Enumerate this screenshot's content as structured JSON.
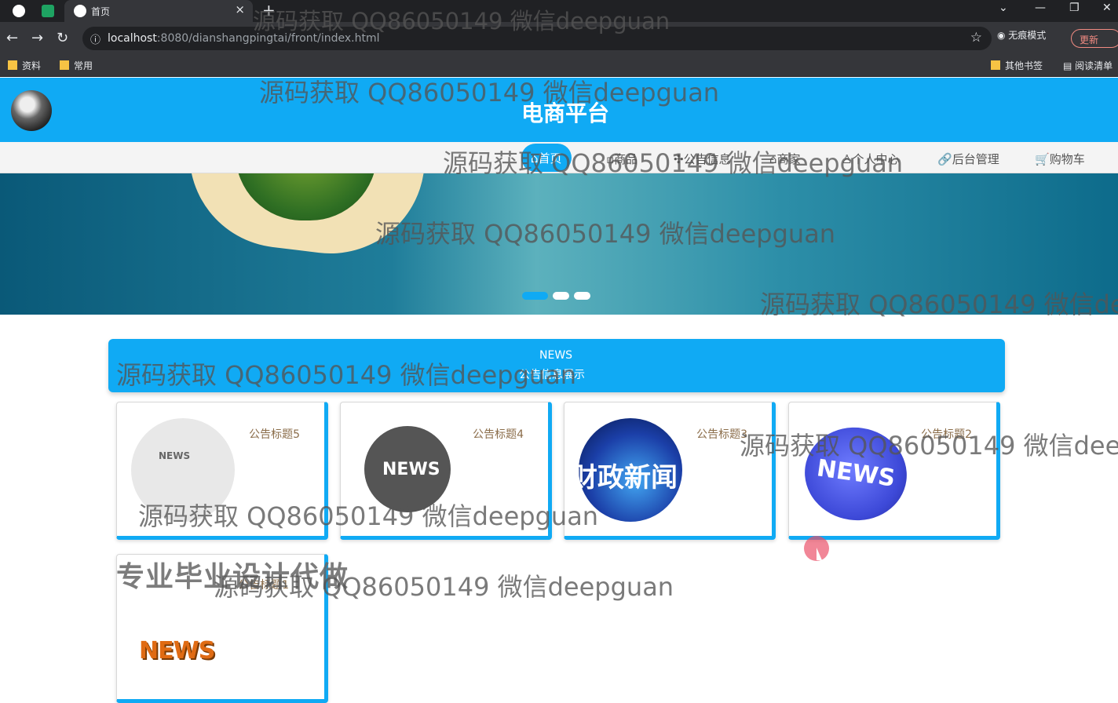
{
  "browser": {
    "tab_title": "首页",
    "tab_close": "×",
    "new_tab": "+",
    "url_host": "localhost",
    "url_path": ":8080/dianshangpingtai/front/index.html",
    "incognito": "无痕模式",
    "update": "更新",
    "bookmarks": [
      "资料",
      "常用",
      "其他书签",
      "阅读清单"
    ]
  },
  "site": {
    "title": "电商平台"
  },
  "nav": {
    "items": [
      "首页",
      "商品",
      "公告信息",
      "商家",
      "个人中心",
      "后台管理",
      "购物车"
    ]
  },
  "notices": {
    "heading_en": "NEWS",
    "heading_cn": "公告信息展示",
    "cards": [
      {
        "title": "公告标题5",
        "image_text": "NEWS"
      },
      {
        "title": "公告标题4",
        "image_text": "NEWS"
      },
      {
        "title": "公告标题3",
        "image_text": "财政新闻"
      },
      {
        "title": "公告标题2",
        "image_text": "NEWS"
      },
      {
        "title": "公告标题1",
        "image_text": "NEWS"
      }
    ]
  },
  "overlay": {
    "watermark": "源码获取 QQ86050149 微信deepguan",
    "promo": "专业毕业设计代做"
  }
}
